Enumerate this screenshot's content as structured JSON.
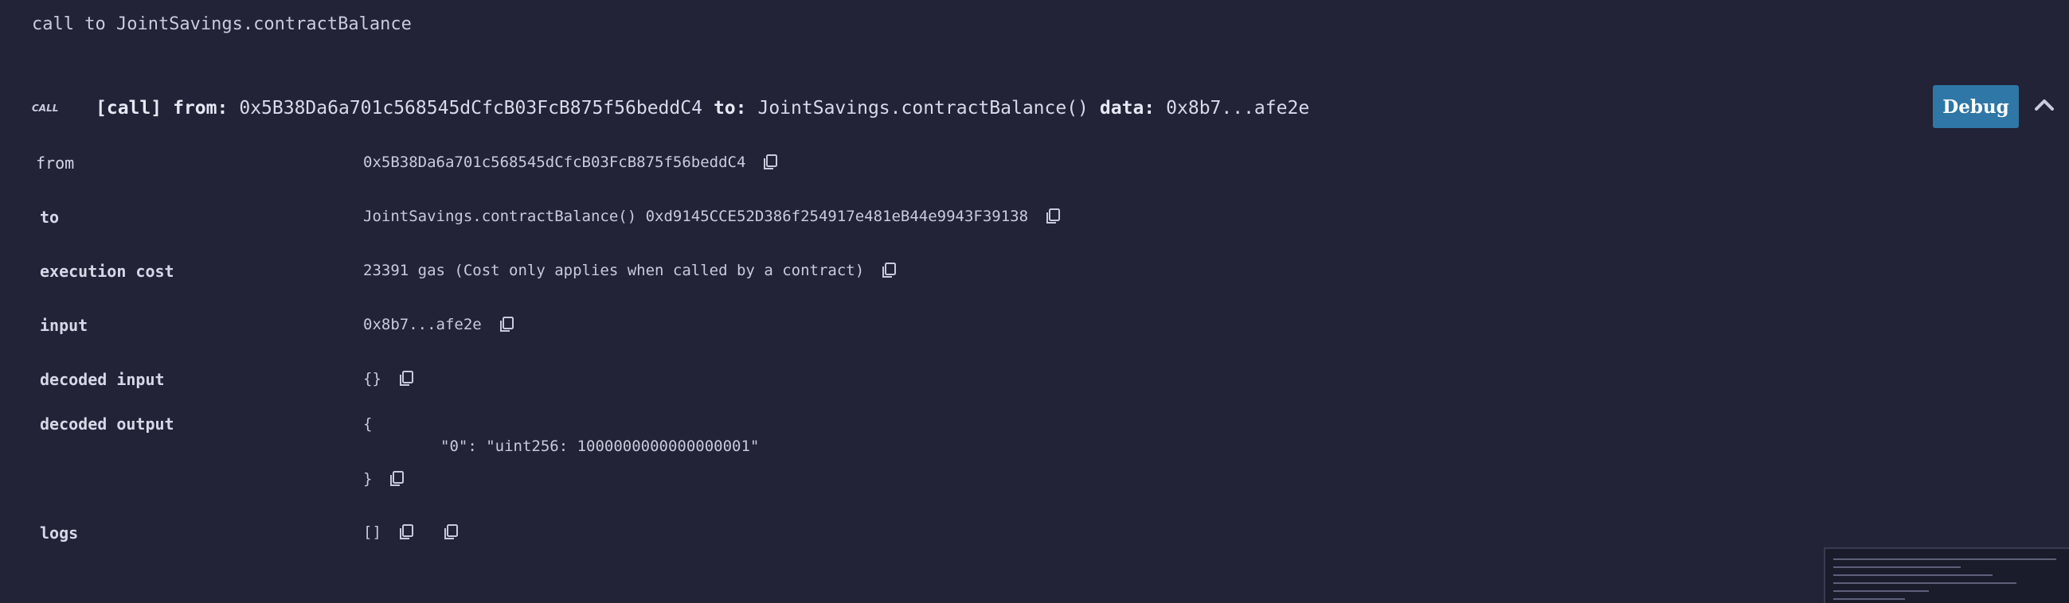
{
  "header": {
    "title": "call to JointSavings.contractBalance"
  },
  "tx": {
    "badge": "CALL",
    "type": "[call]",
    "from_key": "from:",
    "from": "0x5B38Da6a701c568545dCfcB03FcB875f56beddC4",
    "to_key": "to:",
    "to": "JointSavings.contractBalance()",
    "data_key": "data:",
    "data": "0x8b7...afe2e"
  },
  "actions": {
    "debug_label": "Debug",
    "collapse_icon": "chevron-up-icon"
  },
  "details": {
    "from": {
      "label": "from",
      "value": "0x5B38Da6a701c568545dCfcB03FcB875f56beddC4"
    },
    "to": {
      "label": "to",
      "value": "JointSavings.contractBalance() 0xd9145CCE52D386f254917e481eB44e9943F39138"
    },
    "execution_cost": {
      "label": "execution cost",
      "value": "23391 gas (Cost only applies when called by a contract)"
    },
    "input": {
      "label": "input",
      "value": "0x8b7...afe2e"
    },
    "decoded_input": {
      "label": "decoded input",
      "value": "{}"
    },
    "decoded_output": {
      "label": "decoded output",
      "open": "{",
      "entry": "\"0\": \"uint256: 1000000000000000001\"",
      "close": "}"
    },
    "logs": {
      "label": "logs",
      "value": "[]"
    }
  },
  "icons": {
    "copy": "copy-icon"
  },
  "colors": {
    "background": "#222336",
    "text": "#c9cbdc",
    "debug_button": "#2e77a6"
  }
}
